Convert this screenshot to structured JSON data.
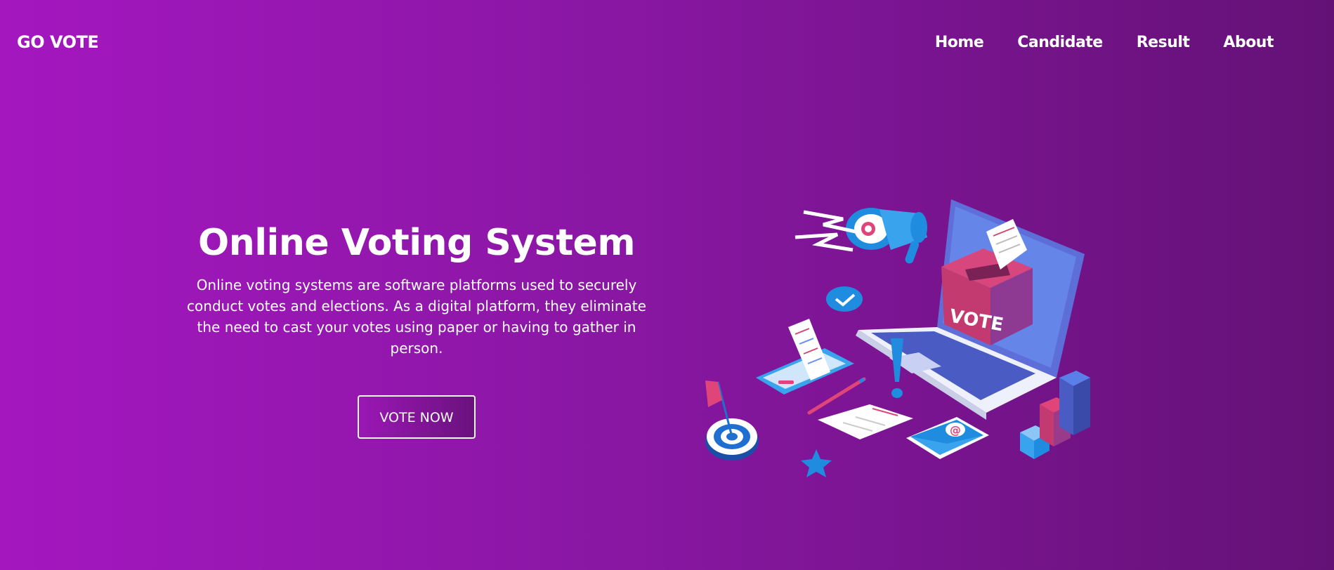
{
  "logo": "GO VOTE",
  "nav": {
    "items": [
      "Home",
      "Candidate",
      "Result",
      "About"
    ]
  },
  "hero": {
    "title": "Online Voting System",
    "description": "Online voting systems are software platforms used to securely conduct votes and elections. As a digital platform, they eliminate the need to cast your votes using paper or having to gather in person.",
    "button_label": "VOTE NOW"
  },
  "illustration": {
    "ballot_box_label": "VOTE",
    "email_symbol": "@",
    "icons": [
      "megaphone-icon",
      "laptop-icon",
      "ballot-box-icon",
      "phone-icon",
      "target-icon",
      "envelope-icon",
      "bar-chart-icon",
      "checkmark-icon",
      "exclamation-icon",
      "star-icon",
      "cube-icon",
      "flag-icon",
      "pencil-icon",
      "document-icon"
    ]
  },
  "colors": {
    "gradient_start": "#a417bf",
    "gradient_end": "#641176",
    "accent_blue": "#1e88e5",
    "accent_pink": "#e0457a"
  }
}
